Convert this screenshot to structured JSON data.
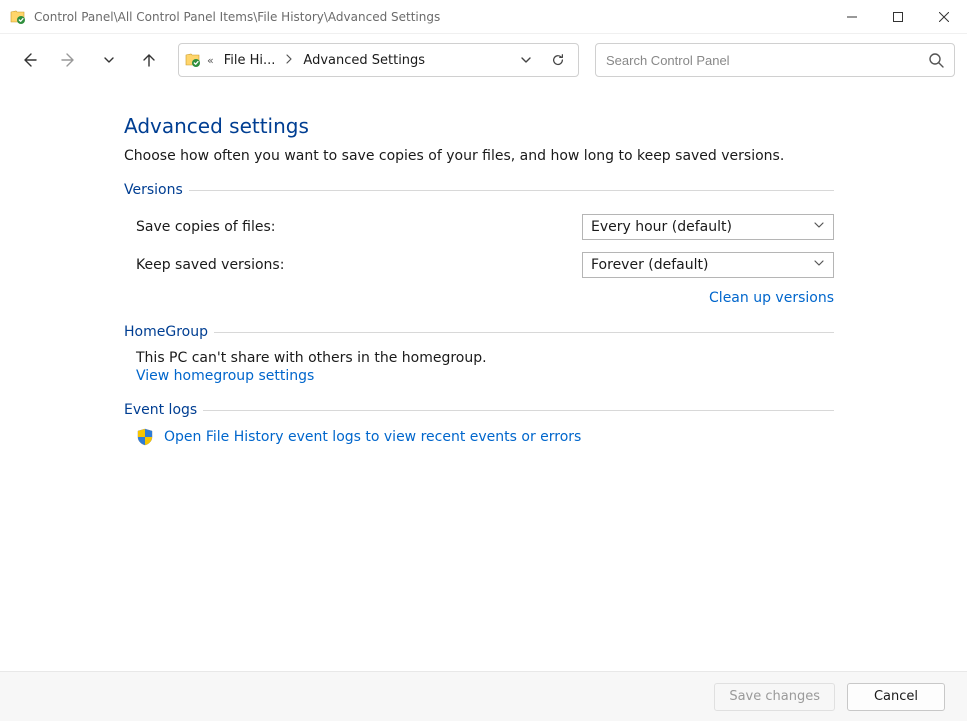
{
  "titlebar": {
    "title": "Control Panel\\All Control Panel Items\\File History\\Advanced Settings"
  },
  "nav": {
    "breadcrumb_seg1": "File Hi...",
    "breadcrumb_seg2": "Advanced Settings"
  },
  "search": {
    "placeholder": "Search Control Panel"
  },
  "page": {
    "title": "Advanced settings",
    "description": "Choose how often you want to save copies of your files, and how long to keep saved versions."
  },
  "versions": {
    "legend": "Versions",
    "save_label": "Save copies of files:",
    "save_value": "Every hour (default)",
    "keep_label": "Keep saved versions:",
    "keep_value": "Forever (default)",
    "cleanup_link": "Clean up versions"
  },
  "homegroup": {
    "legend": "HomeGroup",
    "body": "This PC can't share with others in the homegroup.",
    "link": "View homegroup settings"
  },
  "eventlogs": {
    "legend": "Event logs",
    "link": "Open File History event logs to view recent events or errors"
  },
  "footer": {
    "save_label": "Save changes",
    "cancel_label": "Cancel"
  }
}
